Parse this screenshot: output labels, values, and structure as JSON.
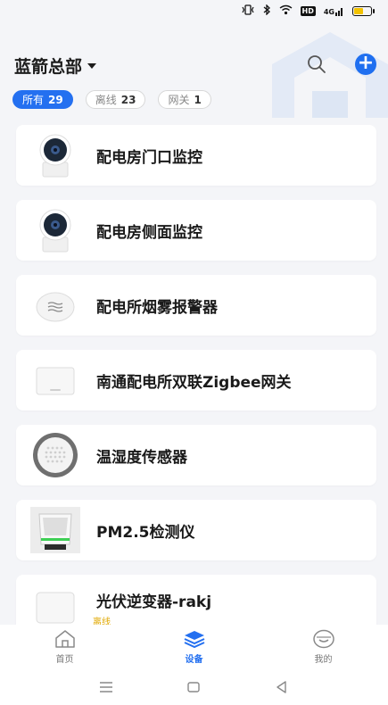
{
  "status_bar": {
    "icons": [
      "vibrate-icon",
      "bluetooth-icon",
      "wifi-icon",
      "hd-icon",
      "signal-icon",
      "battery-icon"
    ],
    "hd": "HD",
    "signal": "4G"
  },
  "header": {
    "org_name": "蓝箭总部",
    "accent": "#2470f0"
  },
  "filters": [
    {
      "label": "所有",
      "count": "29",
      "active": true
    },
    {
      "label": "离线",
      "count": "23",
      "active": false
    },
    {
      "label": "网关",
      "count": "1",
      "active": false
    }
  ],
  "devices": [
    {
      "name": "配电房门口监控",
      "icon": "camera-icon"
    },
    {
      "name": "配电房侧面监控",
      "icon": "camera-icon"
    },
    {
      "name": "配电所烟雾报警器",
      "icon": "smoke-detector-icon"
    },
    {
      "name": "南通配电所双联Zigbee网关",
      "icon": "gateway-icon"
    },
    {
      "name": "温湿度传感器",
      "icon": "thermo-hygro-sensor-icon"
    },
    {
      "name": "PM2.5检测仪",
      "icon": "pm25-monitor-icon"
    },
    {
      "name": "光伏逆变器-rakj",
      "icon": "inverter-icon",
      "status": "离线"
    }
  ],
  "nav": [
    {
      "label": "首页",
      "icon": "home-icon",
      "active": false
    },
    {
      "label": "设备",
      "icon": "devices-layers-icon",
      "active": true
    },
    {
      "label": "我的",
      "icon": "profile-icon",
      "active": false
    }
  ],
  "system_bar": [
    "menu-icon",
    "home-square-icon",
    "back-triangle-icon"
  ]
}
